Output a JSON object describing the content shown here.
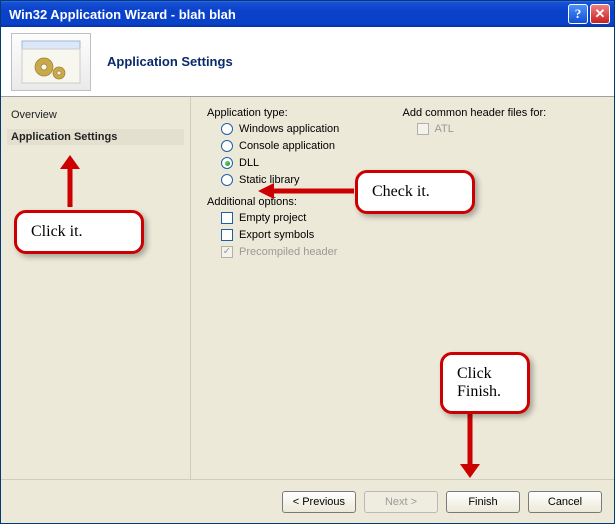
{
  "window": {
    "title": "Win32 Application Wizard - blah blah",
    "help_btn": "?",
    "close_btn": "✕"
  },
  "header": {
    "title": "Application Settings"
  },
  "sidebar": {
    "items": [
      {
        "label": "Overview",
        "active": false
      },
      {
        "label": "Application Settings",
        "active": true
      }
    ]
  },
  "content": {
    "app_type_label": "Application type:",
    "app_type": {
      "options": [
        {
          "label": "Windows application",
          "checked": false
        },
        {
          "label": "Console application",
          "checked": false
        },
        {
          "label": "DLL",
          "checked": true
        },
        {
          "label": "Static library",
          "checked": false
        }
      ]
    },
    "additional_label": "Additional options:",
    "additional": {
      "options": [
        {
          "label": "Empty project",
          "checked": false,
          "disabled": false
        },
        {
          "label": "Export symbols",
          "checked": false,
          "disabled": false
        },
        {
          "label": "Precompiled header",
          "checked": true,
          "disabled": true
        }
      ]
    },
    "common_header_label": "Add common header files for:",
    "common": {
      "options": [
        {
          "label": "ATL",
          "checked": false,
          "disabled": true
        }
      ]
    }
  },
  "buttons": {
    "previous": "< Previous",
    "next": "Next >",
    "finish": "Finish",
    "cancel": "Cancel"
  },
  "annotations": {
    "click_sidebar": "Click it.",
    "check_dll": "Check it.",
    "click_finish": "Click\nFinish."
  }
}
